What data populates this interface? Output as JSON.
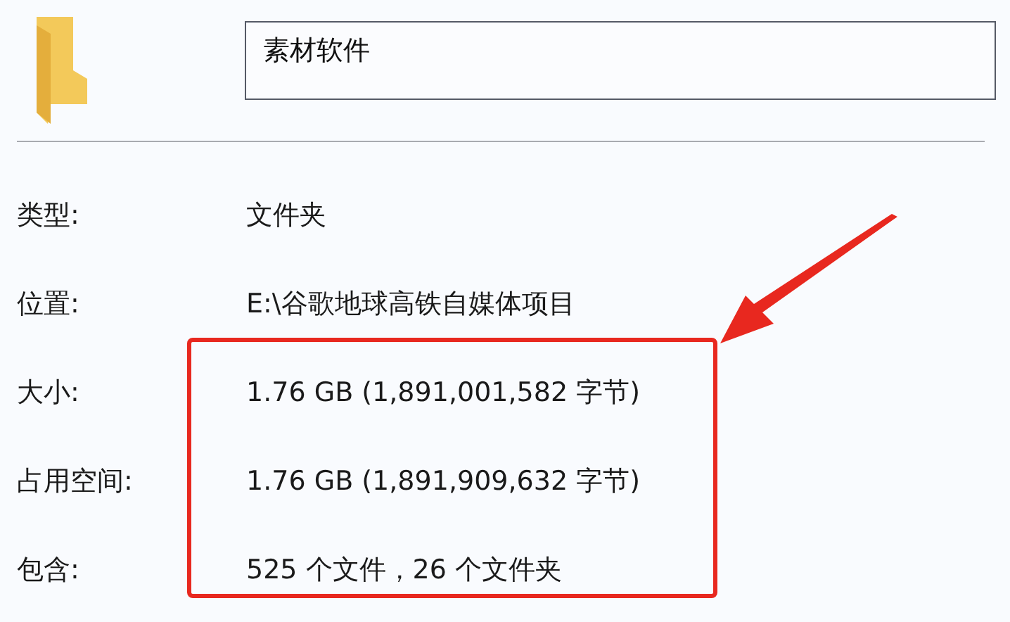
{
  "name_field": {
    "value": "素材软件"
  },
  "properties": [
    {
      "label": "类型:",
      "value": "文件夹"
    },
    {
      "label": "位置:",
      "value": "E:\\谷歌地球高铁自媒体项目"
    },
    {
      "label": "大小:",
      "value": "1.76 GB (1,891,001,582 字节)"
    },
    {
      "label": "占用空间:",
      "value": "1.76 GB (1,891,909,632 字节)"
    },
    {
      "label": "包含:",
      "value": "525 个文件，26 个文件夹"
    }
  ]
}
